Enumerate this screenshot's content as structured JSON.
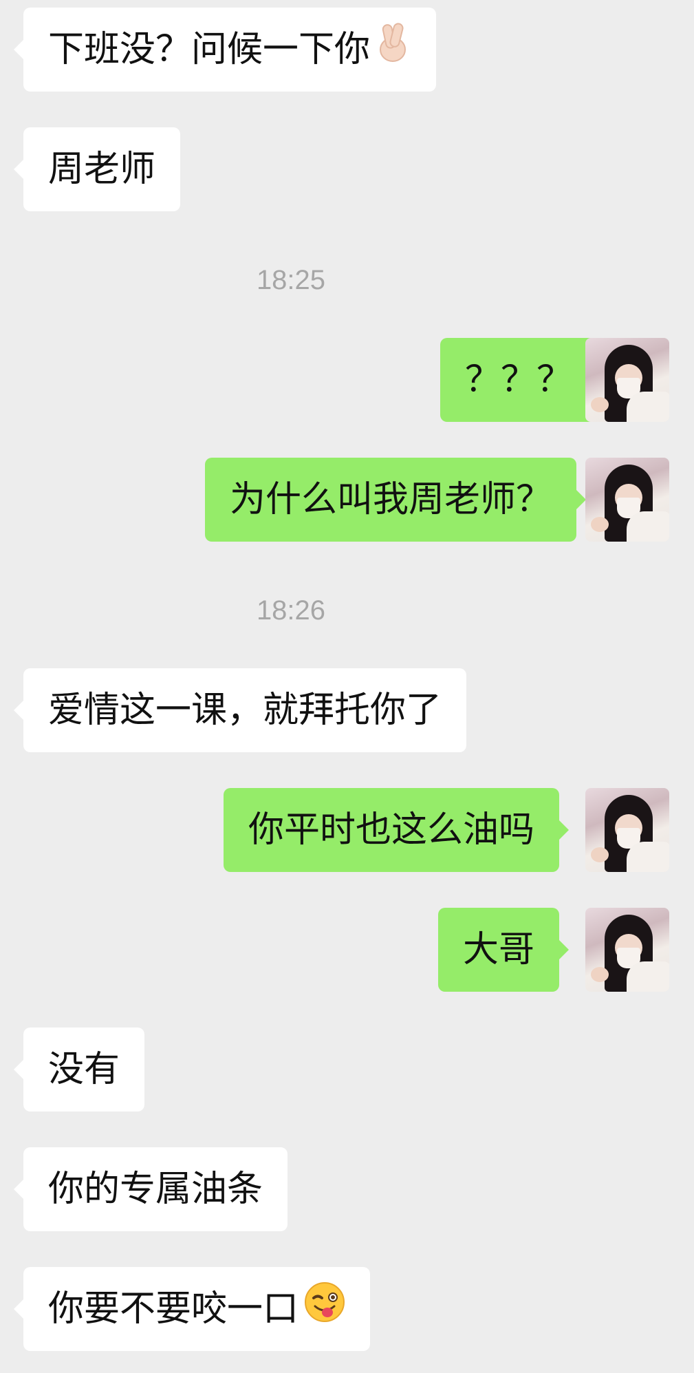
{
  "messages": [
    {
      "side": "left",
      "text": "下班没？问候一下你",
      "emoji": "finger-heart-icon"
    },
    {
      "side": "left",
      "text": "周老师"
    },
    {
      "type": "time",
      "text": "18:25"
    },
    {
      "side": "right",
      "text": "？？？"
    },
    {
      "side": "right",
      "text": "为什么叫我周老师？"
    },
    {
      "type": "time",
      "text": "18:26"
    },
    {
      "side": "left",
      "text": "爱情这一课，就拜托你了"
    },
    {
      "side": "right",
      "text": "你平时也这么油吗"
    },
    {
      "side": "right",
      "text": "大哥"
    },
    {
      "side": "left",
      "text": "没有"
    },
    {
      "side": "left",
      "text": "你的专属油条"
    },
    {
      "side": "left",
      "text": "你要不要咬一口",
      "emoji": "winking-tongue-face-icon"
    }
  ],
  "colors": {
    "background": "#ededed",
    "incoming_bubble": "#ffffff",
    "outgoing_bubble": "#95ec69",
    "timestamp": "#a6a6a6"
  },
  "avatar_icon": "user-avatar-photo"
}
